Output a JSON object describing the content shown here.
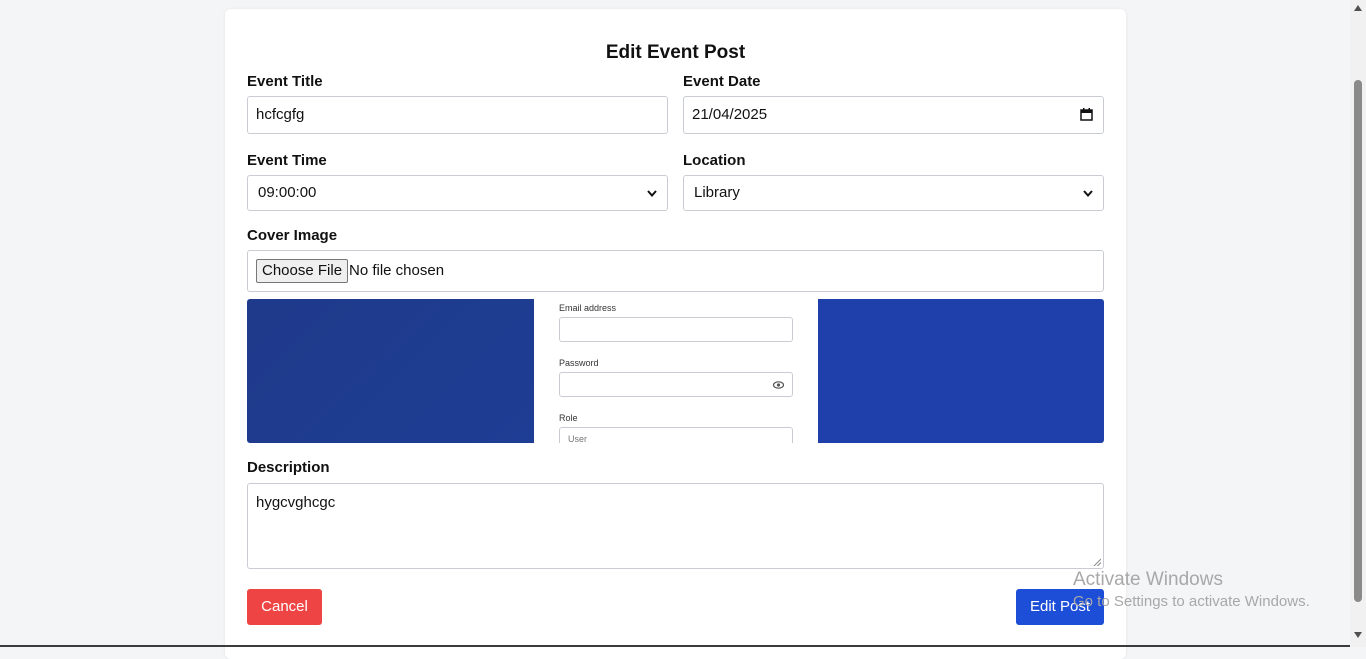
{
  "form": {
    "title": "Edit Event Post",
    "event_title": {
      "label": "Event Title",
      "value": "hcfcgfg"
    },
    "event_date": {
      "label": "Event Date",
      "value": "21/04/2025"
    },
    "event_time": {
      "label": "Event Time",
      "value": "09:00:00"
    },
    "location": {
      "label": "Location",
      "value": "Library"
    },
    "cover_image": {
      "label": "Cover Image",
      "button": "Choose File",
      "status": "No file chosen",
      "preview": {
        "email_label": "Email address",
        "password_label": "Password",
        "role_label": "Role",
        "role_value": "User"
      }
    },
    "description": {
      "label": "Description",
      "value": "hygcvghcgc"
    },
    "cancel_button": "Cancel",
    "submit_button": "Edit Post"
  },
  "watermark": {
    "line1": "Activate Windows",
    "line2": "Go to Settings to activate Windows."
  },
  "colors": {
    "cancel": "#ef4444",
    "submit": "#1d4ed8",
    "preview_blue": "#1f40aa"
  }
}
